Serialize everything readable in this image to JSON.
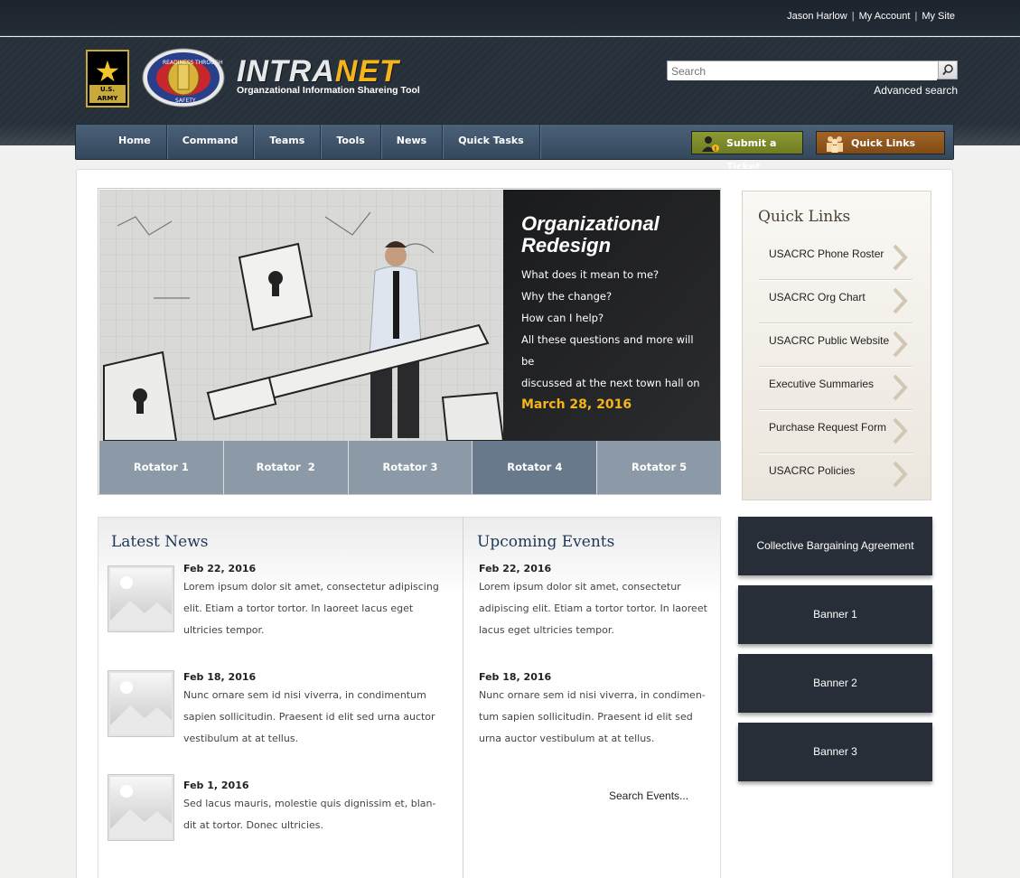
{
  "user": {
    "name": "Jason Harlow",
    "account": "My Account",
    "site": "My Site"
  },
  "brand": {
    "logo_text": "U.S. ARMY",
    "title_a": "INTRA",
    "title_b": "NET",
    "subtitle": "Organzational Information Shareing Tool",
    "seal_top": "READINESS THROUGH",
    "seal_bottom": "SAFETY"
  },
  "search": {
    "placeholder": "Search",
    "advanced": "Advanced search"
  },
  "nav": {
    "items": [
      "Home",
      "Command",
      "Teams",
      "Tools",
      "News",
      "Quick Tasks"
    ],
    "ticket": "Submit a Ticket",
    "quick_links": "Quick Links"
  },
  "hero": {
    "title_1": "Organizational",
    "title_2": "Redesign",
    "lines": [
      "What does it mean to me?",
      "Why the change?",
      "How can I help?",
      "All these questions and more will be",
      "discussed at the next town hall on"
    ],
    "date": "March 28, 2016",
    "rotators": [
      "Rotator 1",
      "Rotator  2",
      "Rotator 3",
      "Rotator 4",
      "Rotator 5"
    ],
    "active_rotator": 3
  },
  "quick_links": {
    "title": "Quick Links",
    "items": [
      "USACRC Phone Roster",
      "USACRC Org Chart",
      "USACRC Public Website",
      "Executive Summaries",
      "Purchase Request Form",
      "USACRC Policies"
    ]
  },
  "news": {
    "title": "Latest News",
    "items": [
      {
        "date": "Feb 22, 2016",
        "lines": [
          "Lorem ipsum dolor sit amet, consectetur adipiscing",
          "elit. Etiam a tortor tortor. In laoreet lacus eget",
          "ultricies tempor."
        ]
      },
      {
        "date": "Feb 18, 2016",
        "lines": [
          "Nunc ornare sem id nisi viverra, in condimentum",
          "sapien sollicitudin. Praesent id elit sed urna auctor",
          "vestibulum at at tellus."
        ]
      },
      {
        "date": "Feb 1, 2016",
        "lines": [
          "Sed lacus mauris, molestie quis dignissim et, blan-",
          "dit at tortor. Donec ultricies."
        ]
      }
    ]
  },
  "events": {
    "title": "Upcoming Events",
    "items": [
      {
        "date": "Feb 22, 2016",
        "lines": [
          "Lorem ipsum dolor sit amet, consectetur",
          "adipiscing elit. Etiam a tortor tortor. In laoreet",
          "lacus eget ultricies tempor."
        ]
      },
      {
        "date": "Feb 18, 2016",
        "lines": [
          "Nunc ornare sem id nisi viverra, in condimen-",
          "tum sapien sollicitudin. Praesent id elit sed",
          "urna auctor vestibulum at at tellus."
        ]
      }
    ],
    "search": "Search Events..."
  },
  "banners": [
    "Collective Bargaining Agreement",
    "Banner 1",
    "Banner 2",
    "Banner 3"
  ],
  "colors": {
    "accent": "#f4b51c",
    "nav": "#3f5368",
    "banner": "#282e37",
    "rotator": "#8b9aa6"
  }
}
